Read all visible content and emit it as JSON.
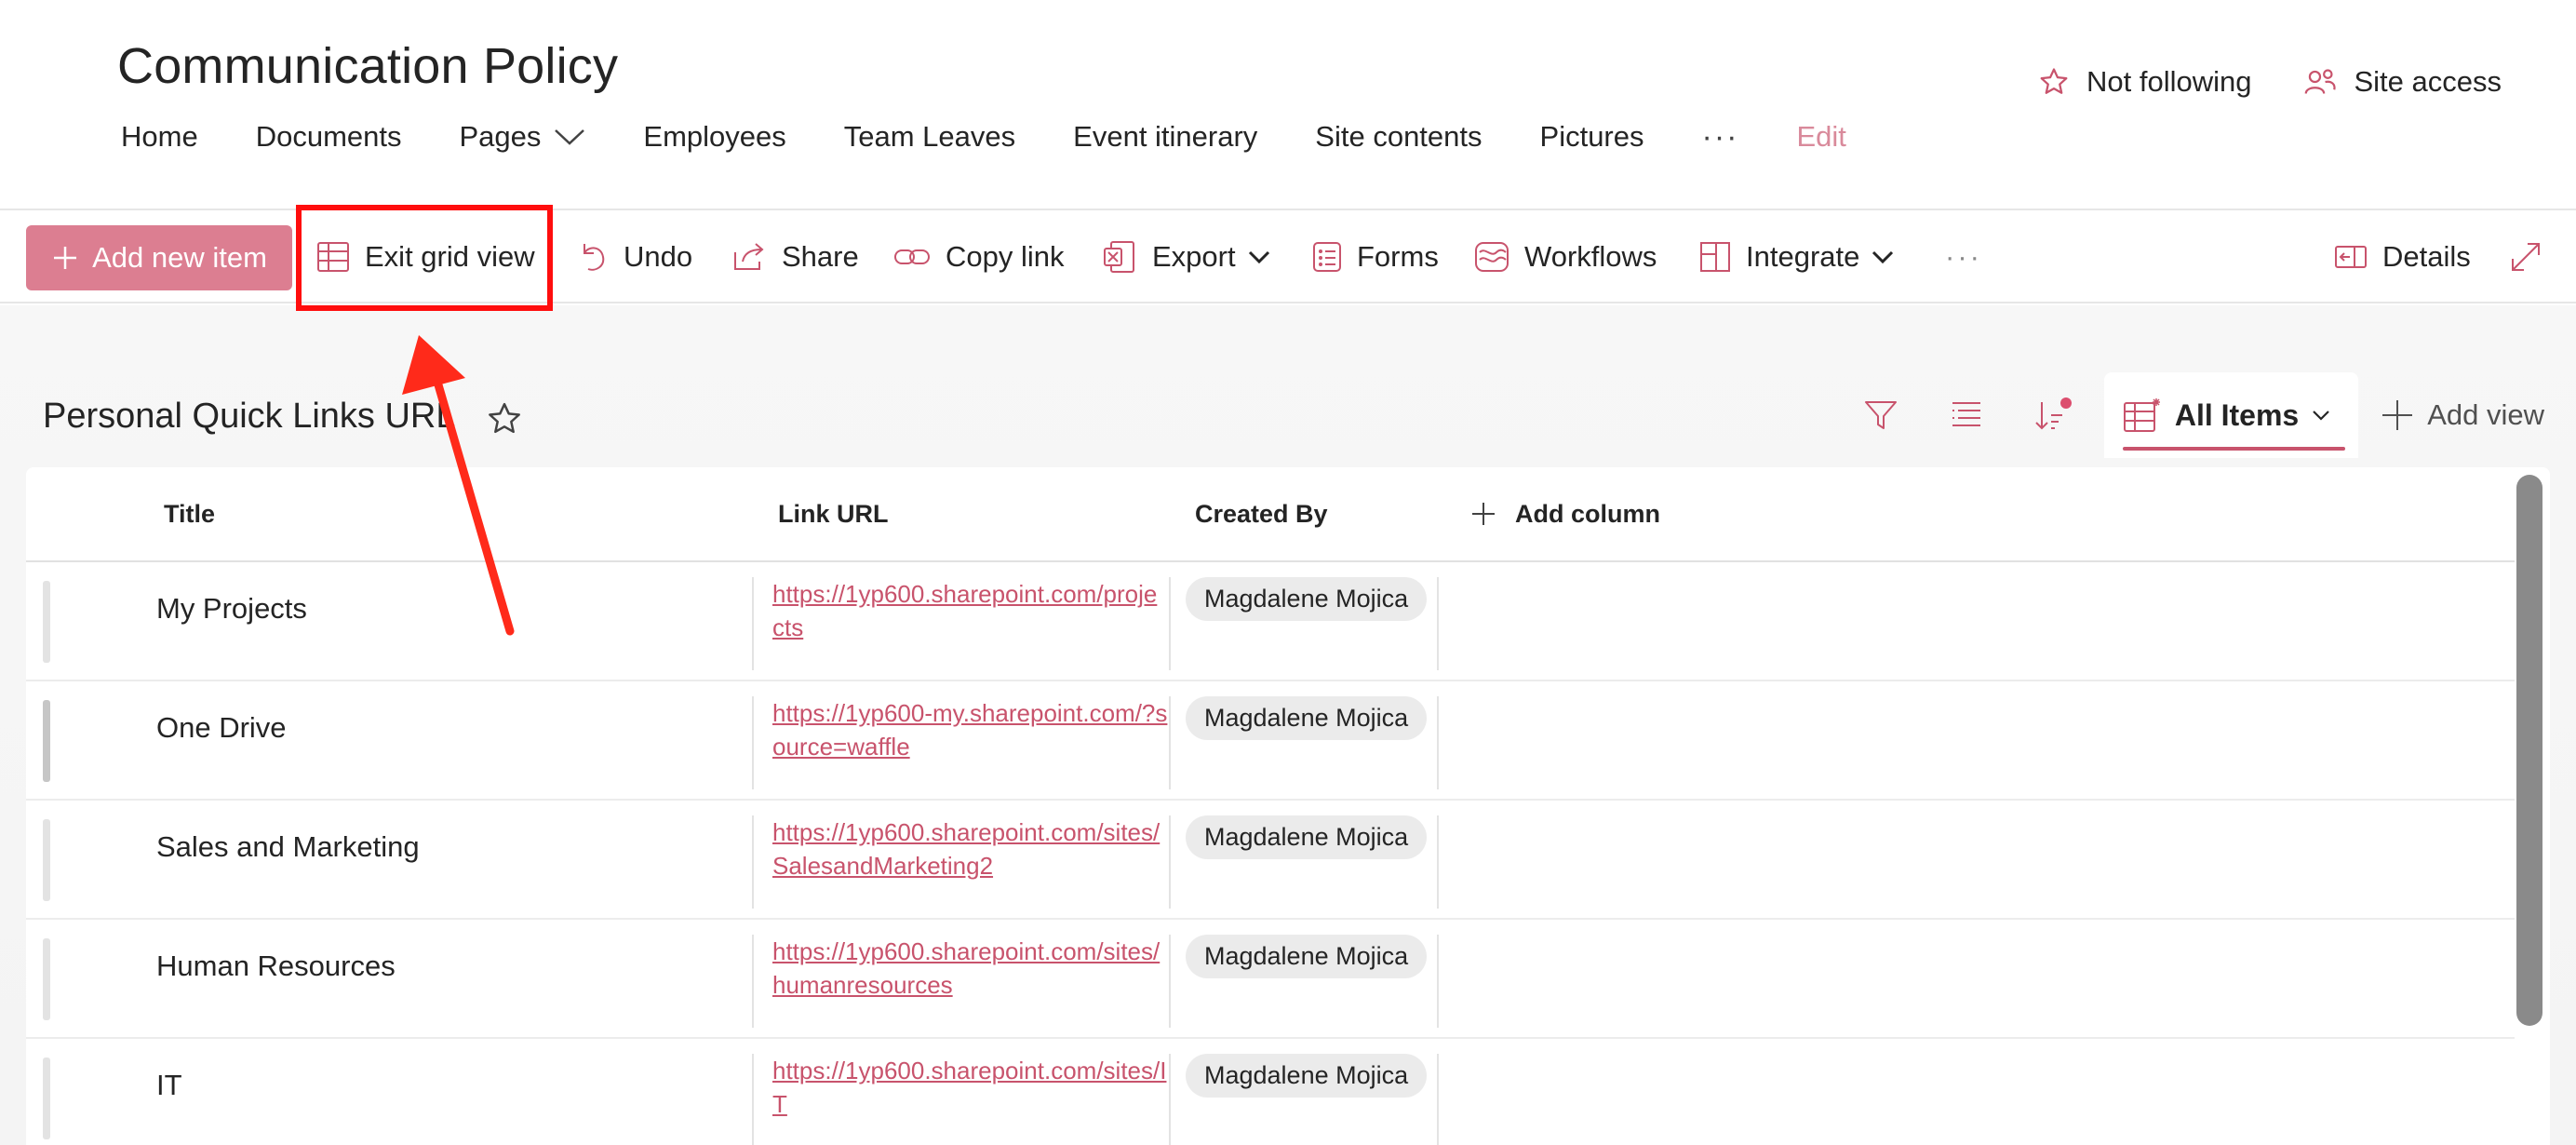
{
  "site": {
    "title": "Communication Policy",
    "nav": [
      {
        "label": "Home"
      },
      {
        "label": "Documents"
      },
      {
        "label": "Pages",
        "has_dropdown": true
      },
      {
        "label": "Employees"
      },
      {
        "label": "Team Leaves"
      },
      {
        "label": "Event itinerary"
      },
      {
        "label": "Site contents"
      },
      {
        "label": "Pictures"
      }
    ],
    "nav_more": "···",
    "nav_edit": "Edit",
    "follow_label": "Not following",
    "site_access_label": "Site access"
  },
  "toolbar": {
    "add_new_item": "Add new item",
    "exit_grid_view": "Exit grid view",
    "undo": "Undo",
    "share": "Share",
    "copy_link": "Copy link",
    "export": "Export",
    "forms": "Forms",
    "workflows": "Workflows",
    "integrate": "Integrate",
    "more": "···",
    "details": "Details"
  },
  "list": {
    "title": "Personal Quick Links URL",
    "current_view": "All Items",
    "add_view": "Add view",
    "columns": {
      "title": "Title",
      "link_url": "Link URL",
      "created_by": "Created By",
      "add_column": "Add column"
    },
    "rows": [
      {
        "title": "My Projects",
        "link_url": "https://1yp600.sharepoint.com/projects",
        "created_by": "Magdalene Mojica"
      },
      {
        "title": "One Drive",
        "link_url": "https://1yp600-my.sharepoint.com/?source=waffle",
        "created_by": "Magdalene Mojica"
      },
      {
        "title": "Sales and Marketing",
        "link_url": "https://1yp600.sharepoint.com/sites/SalesandMarketing2",
        "created_by": "Magdalene Mojica"
      },
      {
        "title": "Human Resources",
        "link_url": "https://1yp600.sharepoint.com/sites/humanresources",
        "created_by": "Magdalene Mojica"
      },
      {
        "title": "IT",
        "link_url": "https://1yp600.sharepoint.com/sites/IT",
        "created_by": "Magdalene Mojica"
      }
    ]
  },
  "colors": {
    "accent": "#c8536c",
    "primary_button": "#dc7e91",
    "annotation": "#ff0d0d"
  }
}
